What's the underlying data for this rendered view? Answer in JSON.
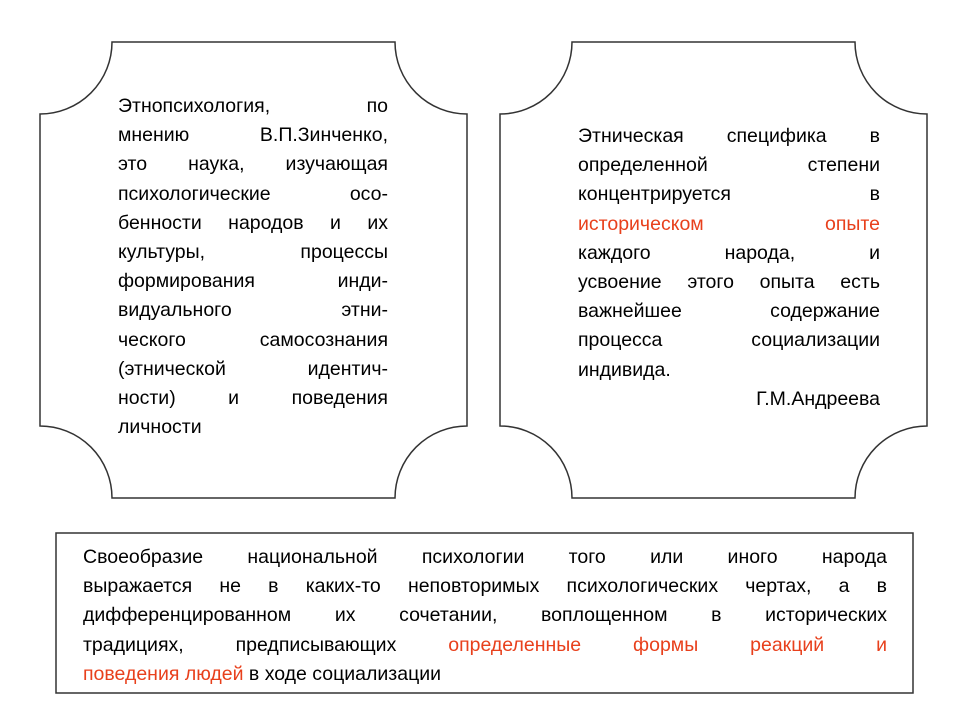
{
  "colors": {
    "text": "#000000",
    "accent": "#e8401c",
    "border": "#333333"
  },
  "left_card": {
    "lines": [
      [
        {
          "t": "Этнопсихология,                    по"
        }
      ],
      [
        {
          "t": "мнению   В.П.Зинченко,"
        }
      ],
      [
        {
          "t": "это  наука,  изучающая"
        }
      ],
      [
        {
          "t": "психологические    осо-"
        }
      ],
      [
        {
          "t": "бенности народов и их"
        }
      ],
      [
        {
          "t": "культуры,      процессы"
        }
      ],
      [
        {
          "t": "формирования     инди-"
        }
      ],
      [
        {
          "t": "видуального          этни-"
        }
      ],
      [
        {
          "t": "ческого  самосознания"
        }
      ],
      [
        {
          "t": "(этнической   идентич-"
        }
      ],
      [
        {
          "t": "ности)    и    поведения"
        }
      ],
      [
        {
          "t": "личности",
          "last": true
        }
      ]
    ]
  },
  "right_card": {
    "lines": [
      [
        {
          "t": "Этническая специфика в"
        }
      ],
      [
        {
          "t": "определенной      степени"
        }
      ],
      [
        {
          "t": "концентрируется            в"
        }
      ],
      [
        {
          "t": "историческом       опыте",
          "red": true
        }
      ],
      [
        {
          "t": "каждого     народа,       и"
        }
      ],
      [
        {
          "t": "усвоение этого опыта есть"
        }
      ],
      [
        {
          "t": "важнейшее    содержание"
        }
      ],
      [
        {
          "t": "процесса    социализации"
        }
      ],
      [
        {
          "t": "индивида.",
          "last": true
        }
      ]
    ],
    "author": "Г.М.Андреева"
  },
  "bottom_box": {
    "lines": [
      [
        {
          "t": "Своеобразие   национальной   психологии   того   или   иного   народа"
        }
      ],
      [
        {
          "t": "выражается не в каких-то неповторимых психологических чертах, а в"
        }
      ],
      [
        {
          "t": "дифференцированном  их  сочетании,  воплощенном  в  исторических"
        }
      ],
      [
        {
          "t": "традициях,   предписывающих   "
        },
        {
          "t": "определенные   формы   реакций   и",
          "red": true
        }
      ],
      [
        {
          "t": "поведения людей",
          "red": true
        },
        {
          "t": " в ходе социализации",
          "last": true
        }
      ]
    ]
  }
}
